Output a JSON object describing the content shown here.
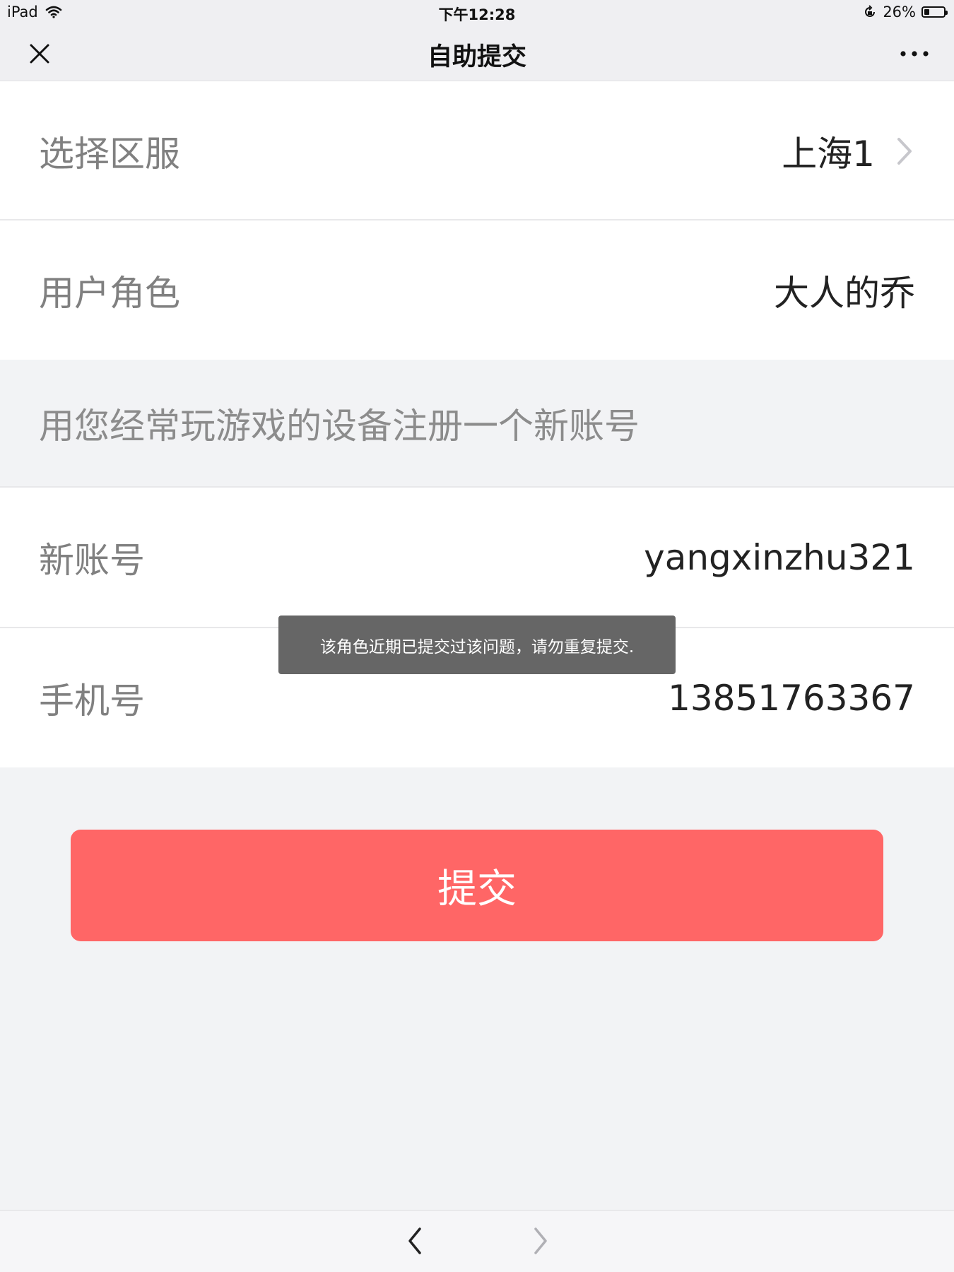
{
  "status_bar": {
    "device": "iPad",
    "time": "下午12:28",
    "battery_percent": "26%",
    "battery_level": 0.26
  },
  "nav": {
    "title": "自助提交",
    "close_icon": "close-icon",
    "more_icon": "more-icon"
  },
  "form": {
    "region": {
      "label": "选择区服",
      "value": "上海1"
    },
    "role": {
      "label": "用户角色",
      "value": "大人的乔"
    },
    "hint": "用您经常玩游戏的设备注册一个新账号",
    "account": {
      "label": "新账号",
      "value": "yangxinzhu321"
    },
    "phone": {
      "label": "手机号",
      "value": "13851763367"
    }
  },
  "toast": "该角色近期已提交过该问题，请勿重复提交.",
  "submit_label": "提交",
  "colors": {
    "submit_bg": "#ff6666",
    "page_bg": "#f2f3f5",
    "toast_bg": "#666666"
  }
}
